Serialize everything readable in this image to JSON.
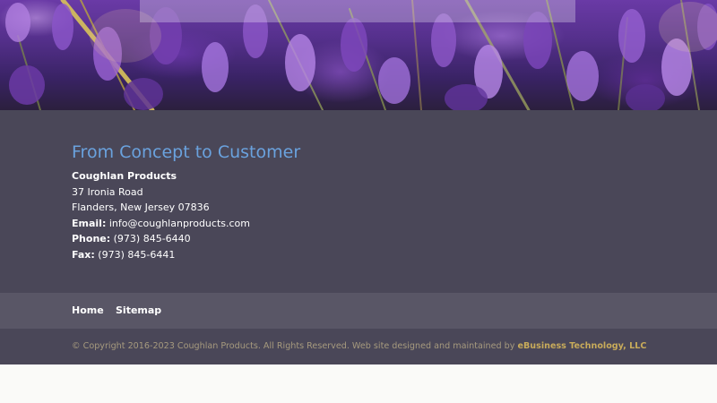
{
  "hero": {
    "image_alt": "",
    "colors": {
      "lavender": "#6a3aa6",
      "stem": "#c9b24a"
    }
  },
  "contact": {
    "tagline": "From Concept to Customer",
    "company": "Coughlan Products",
    "address_line1": "37 Ironia Road",
    "address_line2": "Flanders, New Jersey 07836",
    "email_label": "Email:",
    "email": "info@coughlanproducts.com",
    "phone_label": "Phone:",
    "phone": "(973) 845-6440",
    "fax_label": "Fax:",
    "fax": "(973) 845-6441"
  },
  "nav": {
    "items": [
      {
        "label": "Home"
      },
      {
        "label": "Sitemap"
      }
    ]
  },
  "footer": {
    "copyright": "© Copyright 2016-2023 Coughlan Products. All Rights Reserved. Web site designed and maintained by ",
    "designer_link": "eBusiness Technology, LLC"
  },
  "colors": {
    "tagline": "#6aa2de",
    "section_bg": "#4a4758",
    "nav_bg": "#595666",
    "copyright_text": "#a69a7e",
    "designer_link": "#c8ab5a"
  }
}
